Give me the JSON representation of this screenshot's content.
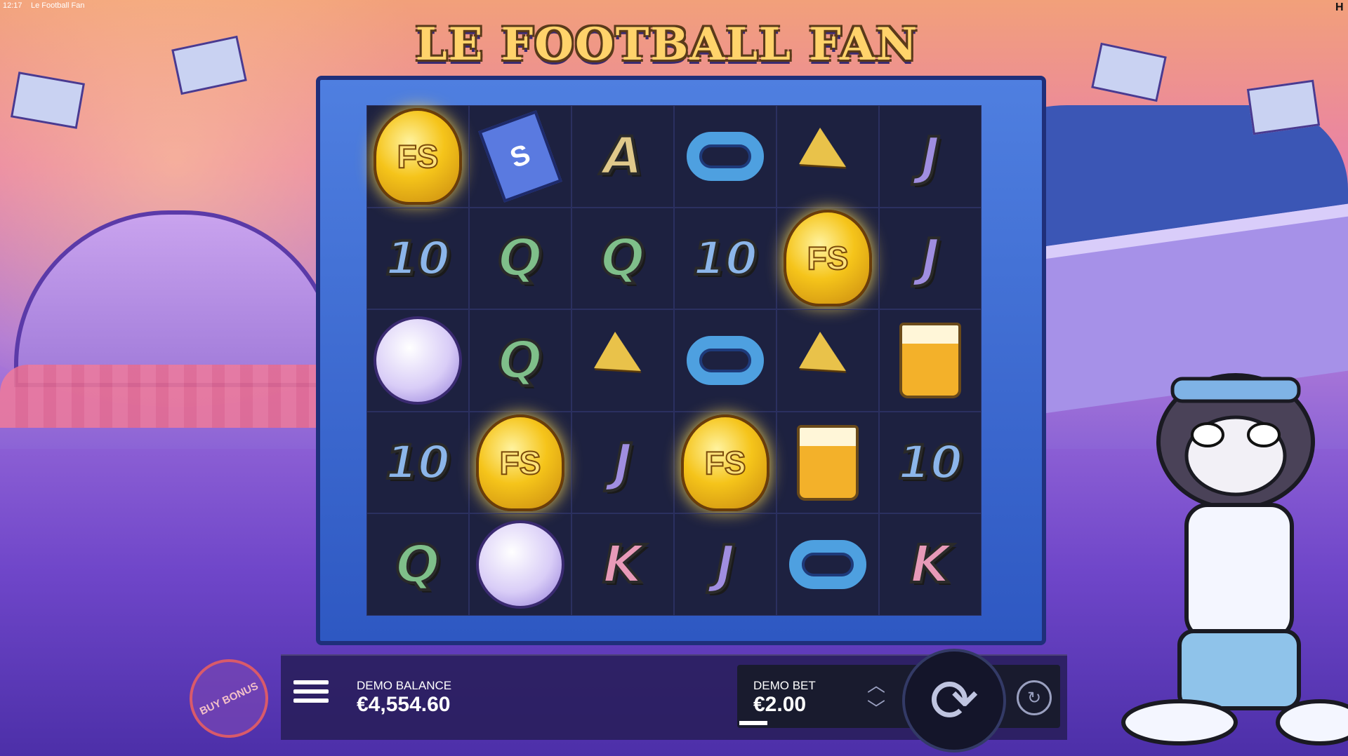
{
  "status_bar": {
    "time": "12:17",
    "window_title": "Le Football Fan",
    "corner_logo": "H"
  },
  "game_title": "LE FOOTBALL FAN",
  "reels": [
    [
      "FS-trophy",
      "ticket",
      "A",
      "scarf",
      "horn",
      "J"
    ],
    [
      "10",
      "Q",
      "Q",
      "10",
      "FS-trophy",
      "J"
    ],
    [
      "ball",
      "Q",
      "horn",
      "scarf",
      "horn",
      "beer"
    ],
    [
      "10",
      "FS-trophy",
      "J",
      "FS-trophy",
      "beer",
      "10"
    ],
    [
      "Q",
      "ball",
      "K",
      "J",
      "scarf",
      "K"
    ]
  ],
  "winning_cells": [
    [
      0,
      0
    ],
    [
      1,
      4
    ],
    [
      3,
      1
    ],
    [
      3,
      3
    ]
  ],
  "bottom_bar": {
    "balance_label": "DEMO BALANCE",
    "balance_value": "€4,554.60",
    "bet_label": "DEMO BET",
    "bet_value": "€2.00",
    "buy_bonus_label": "BUY BONUS",
    "menu_icon": "hamburger-menu-icon",
    "spin_icon": "spin-arrow-icon",
    "autoplay_icon": "autoplay-icon",
    "bet_up_icon": "chevron-up-icon",
    "bet_down_icon": "chevron-down-icon"
  },
  "colors": {
    "accent_gold": "#f5c41a",
    "reel_bg": "#1d2140",
    "frame_blue": "#2e58c2"
  }
}
